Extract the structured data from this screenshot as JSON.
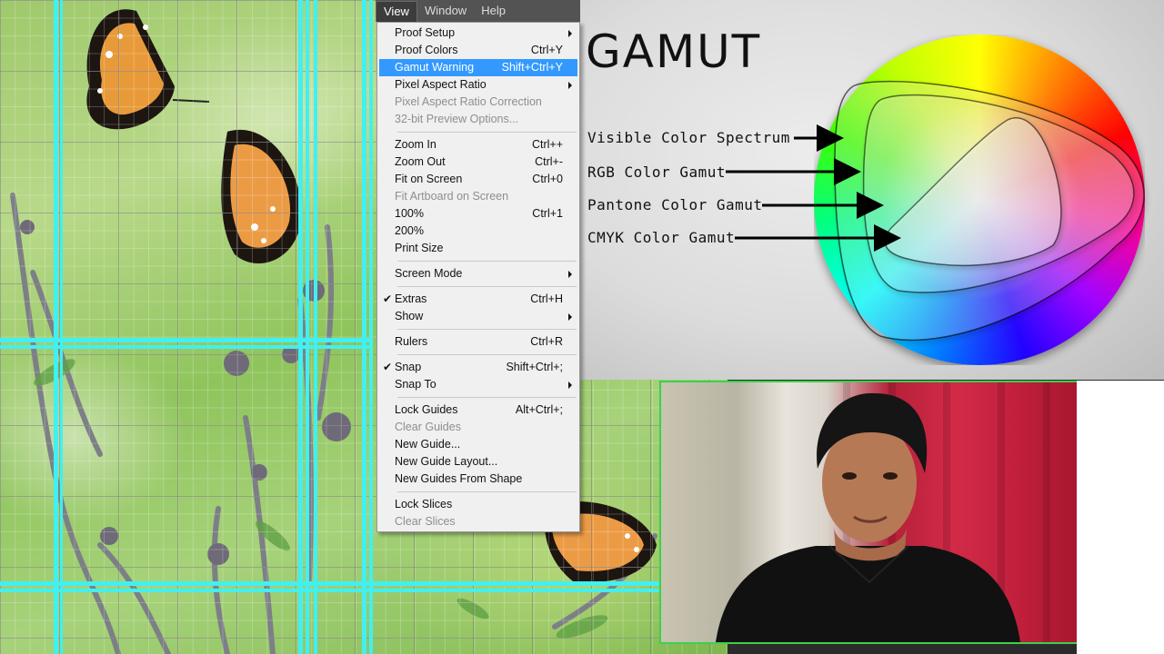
{
  "menubar": {
    "items": [
      {
        "label": "View",
        "active": true
      },
      {
        "label": "Window",
        "active": false
      },
      {
        "label": "Help",
        "active": false
      }
    ]
  },
  "view_menu": {
    "items": [
      {
        "type": "item",
        "label": "Proof Setup",
        "shortcut": "",
        "submenu": true
      },
      {
        "type": "item",
        "label": "Proof Colors",
        "shortcut": "Ctrl+Y"
      },
      {
        "type": "item",
        "label": "Gamut Warning",
        "shortcut": "Shift+Ctrl+Y",
        "highlighted": true
      },
      {
        "type": "item",
        "label": "Pixel Aspect Ratio",
        "shortcut": "",
        "submenu": true
      },
      {
        "type": "item",
        "label": "Pixel Aspect Ratio Correction",
        "shortcut": "",
        "disabled": true
      },
      {
        "type": "item",
        "label": "32-bit Preview Options...",
        "shortcut": "",
        "disabled": true
      },
      {
        "type": "sep"
      },
      {
        "type": "item",
        "label": "Zoom In",
        "shortcut": "Ctrl++"
      },
      {
        "type": "item",
        "label": "Zoom Out",
        "shortcut": "Ctrl+-"
      },
      {
        "type": "item",
        "label": "Fit on Screen",
        "shortcut": "Ctrl+0"
      },
      {
        "type": "item",
        "label": "Fit Artboard on Screen",
        "shortcut": "",
        "disabled": true
      },
      {
        "type": "item",
        "label": "100%",
        "shortcut": "Ctrl+1"
      },
      {
        "type": "item",
        "label": "200%",
        "shortcut": ""
      },
      {
        "type": "item",
        "label": "Print Size",
        "shortcut": ""
      },
      {
        "type": "sep"
      },
      {
        "type": "item",
        "label": "Screen Mode",
        "shortcut": "",
        "submenu": true
      },
      {
        "type": "sep"
      },
      {
        "type": "item",
        "label": "Extras",
        "shortcut": "Ctrl+H",
        "checked": true
      },
      {
        "type": "item",
        "label": "Show",
        "shortcut": "",
        "submenu": true
      },
      {
        "type": "sep"
      },
      {
        "type": "item",
        "label": "Rulers",
        "shortcut": "Ctrl+R"
      },
      {
        "type": "sep"
      },
      {
        "type": "item",
        "label": "Snap",
        "shortcut": "Shift+Ctrl+;",
        "checked": true
      },
      {
        "type": "item",
        "label": "Snap To",
        "shortcut": "",
        "submenu": true
      },
      {
        "type": "sep"
      },
      {
        "type": "item",
        "label": "Lock Guides",
        "shortcut": "Alt+Ctrl+;"
      },
      {
        "type": "item",
        "label": "Clear Guides",
        "shortcut": "",
        "disabled": true
      },
      {
        "type": "item",
        "label": "New Guide...",
        "shortcut": ""
      },
      {
        "type": "item",
        "label": "New Guide Layout...",
        "shortcut": ""
      },
      {
        "type": "item",
        "label": "New Guides From Shape",
        "shortcut": ""
      },
      {
        "type": "sep"
      },
      {
        "type": "item",
        "label": "Lock Slices",
        "shortcut": ""
      },
      {
        "type": "item",
        "label": "Clear Slices",
        "shortcut": "",
        "disabled": true
      }
    ]
  },
  "slide": {
    "title": "GAMUT",
    "labels": [
      "Visible Color Spectrum",
      "RGB Color Gamut",
      "Pantone Color Gamut",
      "CMYK Color Gamut"
    ]
  },
  "colors": {
    "guide": "#41f0f0",
    "menu_highlight": "#3399ff",
    "webcam_border": "#3ad14b"
  }
}
